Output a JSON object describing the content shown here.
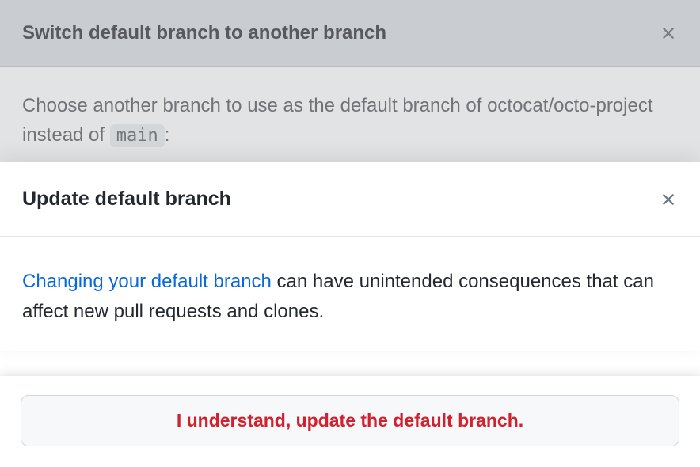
{
  "bg_modal": {
    "title": "Switch default branch to another branch",
    "body_prefix": "Choose another branch to use as the default branch of octocat/octo-project instead of ",
    "code": "main",
    "body_suffix": ":"
  },
  "fg_modal": {
    "title": "Update default branch",
    "link_text": "Changing your default branch",
    "body_rest": " can have unintended consequences that can affect new pull requests and clones."
  },
  "confirm_label": "I understand, update the default branch."
}
